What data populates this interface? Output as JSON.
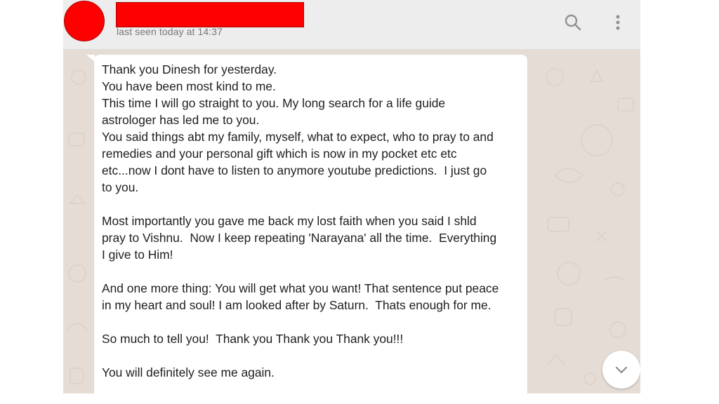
{
  "header": {
    "contact_name": "",
    "status": "last seen today at 14:37",
    "search_icon": "search-icon",
    "menu_icon": "more-vert-icon"
  },
  "message": {
    "text": "Thank you Dinesh for yesterday.\nYou have been most kind to me.\nThis time I will go straight to you. My long search for a life guide\nastrologer has led me to you.\nYou said things abt my family, myself, what to expect, who to pray to and\nremedies and your personal gift which is now in my pocket etc etc\netc...now I dont have to listen to anymore youtube predictions.  I just go\nto you.\n\nMost importantly you gave me back my lost faith when you said I shld\npray to Vishnu.  Now I keep repeating 'Narayana' all the time.  Everything\nI give to Him!\n\nAnd one more thing: You will get what you want! That sentence put peace\nin my heart and soul! I am looked after by Saturn.  Thats enough for me.\n\nSo much to tell you!  Thank you Thank you Thank you!!!\n\nYou will definitely see me again."
  },
  "scroll_button_icon": "chevron-down-icon",
  "colors": {
    "wallpaper": "#e5ddd5",
    "header": "#ededed",
    "bubble": "#ffffff",
    "avatar_redaction": "#ff0000",
    "icon": "#919191"
  }
}
